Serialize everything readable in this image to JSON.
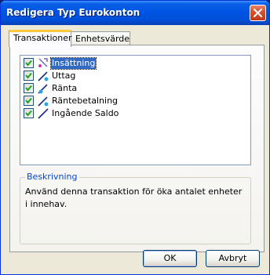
{
  "window": {
    "title": "Redigera Typ Eurokonton"
  },
  "tabs": [
    {
      "label": "Transaktioner",
      "active": true
    },
    {
      "label": "Enhetsvärde",
      "active": false
    }
  ],
  "transactions": [
    {
      "label": "Insättning",
      "checked": true,
      "selected": true,
      "icon": "deposit-icon"
    },
    {
      "label": "Uttag",
      "checked": true,
      "selected": false,
      "icon": "withdrawal-icon"
    },
    {
      "label": "Ränta",
      "checked": true,
      "selected": false,
      "icon": "interest-icon"
    },
    {
      "label": "Räntebetalning",
      "checked": true,
      "selected": false,
      "icon": "interest-payment-icon"
    },
    {
      "label": "Ingående Saldo",
      "checked": true,
      "selected": false,
      "icon": "opening-balance-icon"
    }
  ],
  "description": {
    "legend": "Beskrivning",
    "text": "Använd denna transaktion för öka antalet enheter i innehav."
  },
  "buttons": {
    "ok": "OK",
    "cancel": "Avbryt"
  },
  "colors": {
    "titlebar": "#0054e3",
    "selection": "#316ac5",
    "checkmark": "#21a121",
    "legend_text": "#0046d5"
  }
}
